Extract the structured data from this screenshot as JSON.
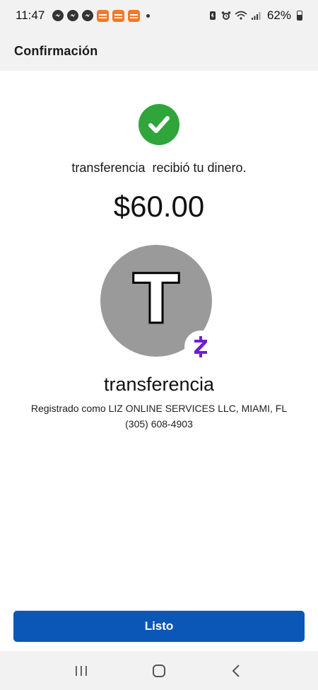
{
  "status_bar": {
    "time": "11:47",
    "battery": "62%",
    "icons": [
      "messenger-icon",
      "messenger-icon",
      "messenger-icon",
      "app-icon",
      "app-icon",
      "app-icon",
      "dot-icon",
      "battery-saver-icon",
      "alarm-icon",
      "wifi-icon",
      "signal-icon",
      "battery-icon"
    ]
  },
  "header": {
    "title": "Confirmación"
  },
  "confirmation": {
    "message": "transferencia  recibió tu dinero.",
    "amount": "$60.00",
    "avatar_letter": "T",
    "recipient_name": "transferencia",
    "registered_as": "Registrado como LIZ ONLINE SERVICES LLC, MIAMI, FL",
    "phone": "(305) 608-4903"
  },
  "actions": {
    "done_label": "Listo"
  },
  "colors": {
    "success": "#2fa53a",
    "primary_button": "#0b57b8",
    "zelle_purple": "#6d1ed4",
    "avatar_bg": "#9a9a9a"
  }
}
